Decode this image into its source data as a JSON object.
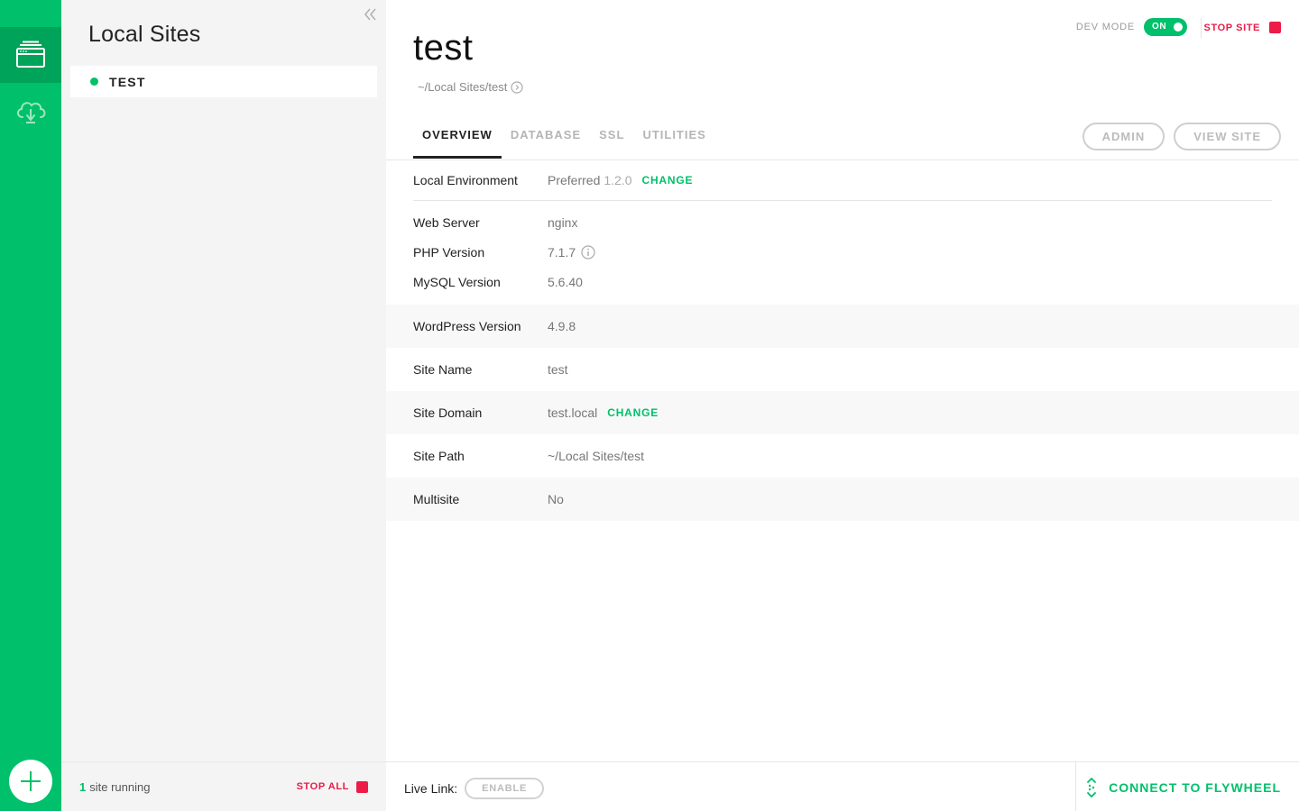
{
  "rail": {
    "items": [
      {
        "icon": "sites-icon",
        "active": true
      },
      {
        "icon": "cloud-icon",
        "active": false
      }
    ],
    "add_icon": "plus-icon"
  },
  "sidebar": {
    "title": "Local Sites",
    "sites": [
      {
        "label": "TEST",
        "status": "running"
      }
    ],
    "footer": {
      "running_count": "1",
      "running_text": "site running",
      "stop_all_label": "STOP ALL"
    }
  },
  "header": {
    "dev_mode_label": "DEV MODE",
    "dev_mode_toggle": "ON",
    "stop_site_label": "STOP SITE",
    "site_title": "test",
    "site_path": "~/Local Sites/test"
  },
  "tabs": [
    {
      "label": "OVERVIEW",
      "active": true
    },
    {
      "label": "DATABASE",
      "active": false
    },
    {
      "label": "SSL",
      "active": false
    },
    {
      "label": "UTILITIES",
      "active": false
    }
  ],
  "actions": {
    "admin_label": "ADMIN",
    "view_site_label": "VIEW SITE"
  },
  "overview": {
    "environment": {
      "label": "Local Environment",
      "value": "Preferred",
      "version": "1.2.0",
      "change_label": "CHANGE"
    },
    "web_server": {
      "label": "Web Server",
      "value": "nginx"
    },
    "php": {
      "label": "PHP Version",
      "value": "7.1.7"
    },
    "mysql": {
      "label": "MySQL Version",
      "value": "5.6.40"
    },
    "wordpress": {
      "label": "WordPress Version",
      "value": "4.9.8"
    },
    "site_name": {
      "label": "Site Name",
      "value": "test"
    },
    "site_domain": {
      "label": "Site Domain",
      "value": "test.local",
      "change_label": "CHANGE"
    },
    "site_path": {
      "label": "Site Path",
      "value": "~/Local Sites/test"
    },
    "multisite": {
      "label": "Multisite",
      "value": "No"
    }
  },
  "footer": {
    "live_link_label": "Live Link:",
    "enable_label": "ENABLE",
    "flywheel_label": "CONNECT TO FLYWHEEL"
  },
  "colors": {
    "brand_green": "#00c06b",
    "brand_green_dark": "#00a35a",
    "stop_red": "#ec1b48"
  }
}
